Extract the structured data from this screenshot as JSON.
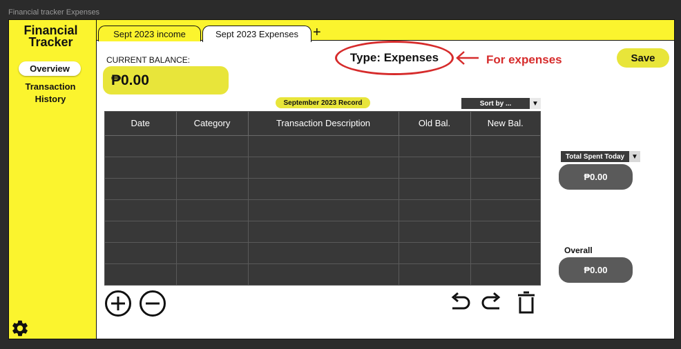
{
  "window": {
    "title": "Financial tracker Expenses"
  },
  "sidebar": {
    "brand_line1": "Financial",
    "brand_line2": "Tracker",
    "items": [
      {
        "label": "Overview",
        "active": true
      },
      {
        "label_line1": "Transaction",
        "label_line2": "History"
      }
    ],
    "settings_icon": "gear-icon"
  },
  "tabs": [
    {
      "label": "Sept 2023 income"
    },
    {
      "label": "Sept 2023 Expenses",
      "active": true
    }
  ],
  "tab_add_label": "+",
  "balance": {
    "label": "CURRENT BALANCE:",
    "value": "₱0.00"
  },
  "type_label": "Type: Expenses",
  "annotation": {
    "text": "For expenses",
    "color": "#d62b2b"
  },
  "save_label": "Save",
  "record_label": "September 2023 Record",
  "sort": {
    "label": "Sort by ...",
    "caret": "▼"
  },
  "table": {
    "columns": [
      "Date",
      "Category",
      "Transaction Description",
      "Old Bal.",
      "New Bal."
    ],
    "rows": [
      [
        "",
        "",
        "",
        "",
        ""
      ],
      [
        "",
        "",
        "",
        "",
        ""
      ],
      [
        "",
        "",
        "",
        "",
        ""
      ],
      [
        "",
        "",
        "",
        "",
        ""
      ],
      [
        "",
        "",
        "",
        "",
        ""
      ],
      [
        "",
        "",
        "",
        "",
        ""
      ],
      [
        "",
        "",
        "",
        "",
        ""
      ]
    ]
  },
  "actions": {
    "add_icon": "plus-circle-icon",
    "remove_icon": "minus-circle-icon",
    "undo_icon": "undo-icon",
    "redo_icon": "redo-icon",
    "delete_icon": "trash-icon"
  },
  "today": {
    "label": "Total Spent Today",
    "caret": "▼",
    "value": "₱0.00"
  },
  "overall": {
    "label": "Overall",
    "value": "₱0.00"
  },
  "colors": {
    "accent_yellow": "#fbf42e",
    "pill_yellow": "#e8e53a",
    "table_bg": "#383838",
    "annotation_red": "#d62b2b"
  }
}
